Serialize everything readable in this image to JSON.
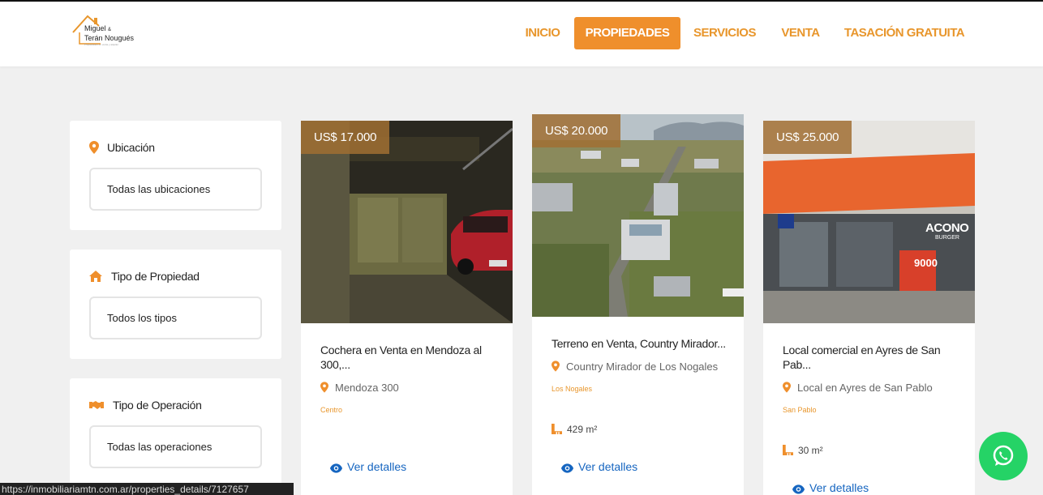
{
  "brand": {
    "line1": "Miguel",
    "amp": "&",
    "line2": "Terán Nougués",
    "tagline": "Propiedades en venta y alquiler"
  },
  "nav": {
    "items": [
      {
        "label": "INICIO"
      },
      {
        "label": "PROPIEDADES"
      },
      {
        "label": "SERVICIOS"
      },
      {
        "label": "VENTA"
      },
      {
        "label": "TASACIÓN GRATUITA"
      }
    ]
  },
  "filters": {
    "ubicacion": {
      "title": "Ubicación",
      "value": "Todas las ubicaciones",
      "icon": "map-pin-icon"
    },
    "tipo": {
      "title": "Tipo de Propiedad",
      "value": "Todos los tipos",
      "icon": "house-icon"
    },
    "operacion": {
      "title": "Tipo de Operación",
      "value": "Todas las operaciones",
      "icon": "handshake-icon"
    }
  },
  "cards": [
    {
      "price": "US$ 17.000",
      "title": "Cochera en Venta en Mendoza al 300,...",
      "location": "Mendoza 300",
      "zone": "Centro",
      "area": "",
      "link": "Ver detalles"
    },
    {
      "price": "US$ 20.000",
      "title": "Terreno en Venta, Country Mirador...",
      "location": "Country Mirador de Los Nogales",
      "zone": "Los Nogales",
      "area": "429 m²",
      "link": "Ver detalles"
    },
    {
      "price": "US$ 25.000",
      "title": "Local comercial en Ayres de San Pab...",
      "location": "Local en Ayres de San Pablo",
      "zone": "San Pablo",
      "area": "30 m²",
      "link": "Ver detalles",
      "shop_sign": "ACONO",
      "shop_sub": "BURGER",
      "shop_price": "9000"
    }
  ],
  "status_url": "https://inmobiliariamtn.com.ar/properties_details/7127657",
  "colors": {
    "accent": "#ef8f2c",
    "link": "#1565c0",
    "whatsapp": "#25d366"
  }
}
